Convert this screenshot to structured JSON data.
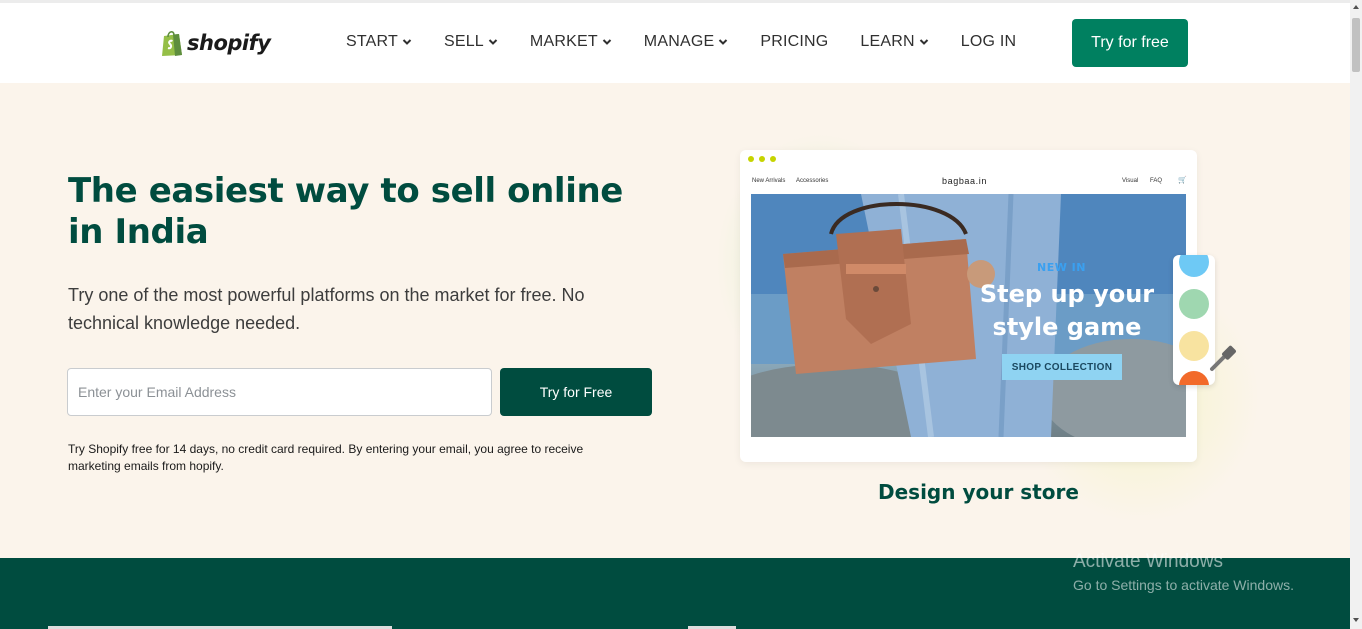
{
  "header": {
    "logo_text": "shopify",
    "nav": [
      {
        "label": "START",
        "dropdown": true
      },
      {
        "label": "SELL",
        "dropdown": true
      },
      {
        "label": "MARKET",
        "dropdown": true
      },
      {
        "label": "MANAGE",
        "dropdown": true
      },
      {
        "label": "PRICING",
        "dropdown": false
      },
      {
        "label": "LEARN",
        "dropdown": true
      },
      {
        "label": "LOG IN",
        "dropdown": false
      }
    ],
    "cta_label": "Try for free"
  },
  "hero": {
    "title": "The easiest way to sell online in India",
    "subtitle": "Try one of the most powerful platforms on the market for free. No technical knowledge needed.",
    "email_placeholder": "Enter your Email Address",
    "cta_label": "Try for Free",
    "disclaimer": "Try Shopify free for 14 days, no credit card required. By entering your email, you agree to receive marketing emails from hopify."
  },
  "illustration": {
    "mini_nav_left": [
      "New Arrivals",
      "Accessories"
    ],
    "brand": "bagbaa.in",
    "mini_nav_right": [
      "Visual",
      "FAQ",
      "🛒"
    ],
    "promo_kicker": "NEW IN",
    "promo_headline_1": "Step up your",
    "promo_headline_2": "style game",
    "promo_button": "SHOP COLLECTION",
    "caption": "Design your store",
    "swatch_colors": [
      "#6ec9f5",
      "#9fd7b0",
      "#f8e3a0",
      "#f26a2a"
    ]
  },
  "watermark": {
    "line1": "Activate Windows",
    "line2": "Go to Settings to activate Windows."
  },
  "colors": {
    "brand_green": "#008060",
    "dark_green": "#004c3f",
    "hero_bg": "#fbf4eb"
  }
}
